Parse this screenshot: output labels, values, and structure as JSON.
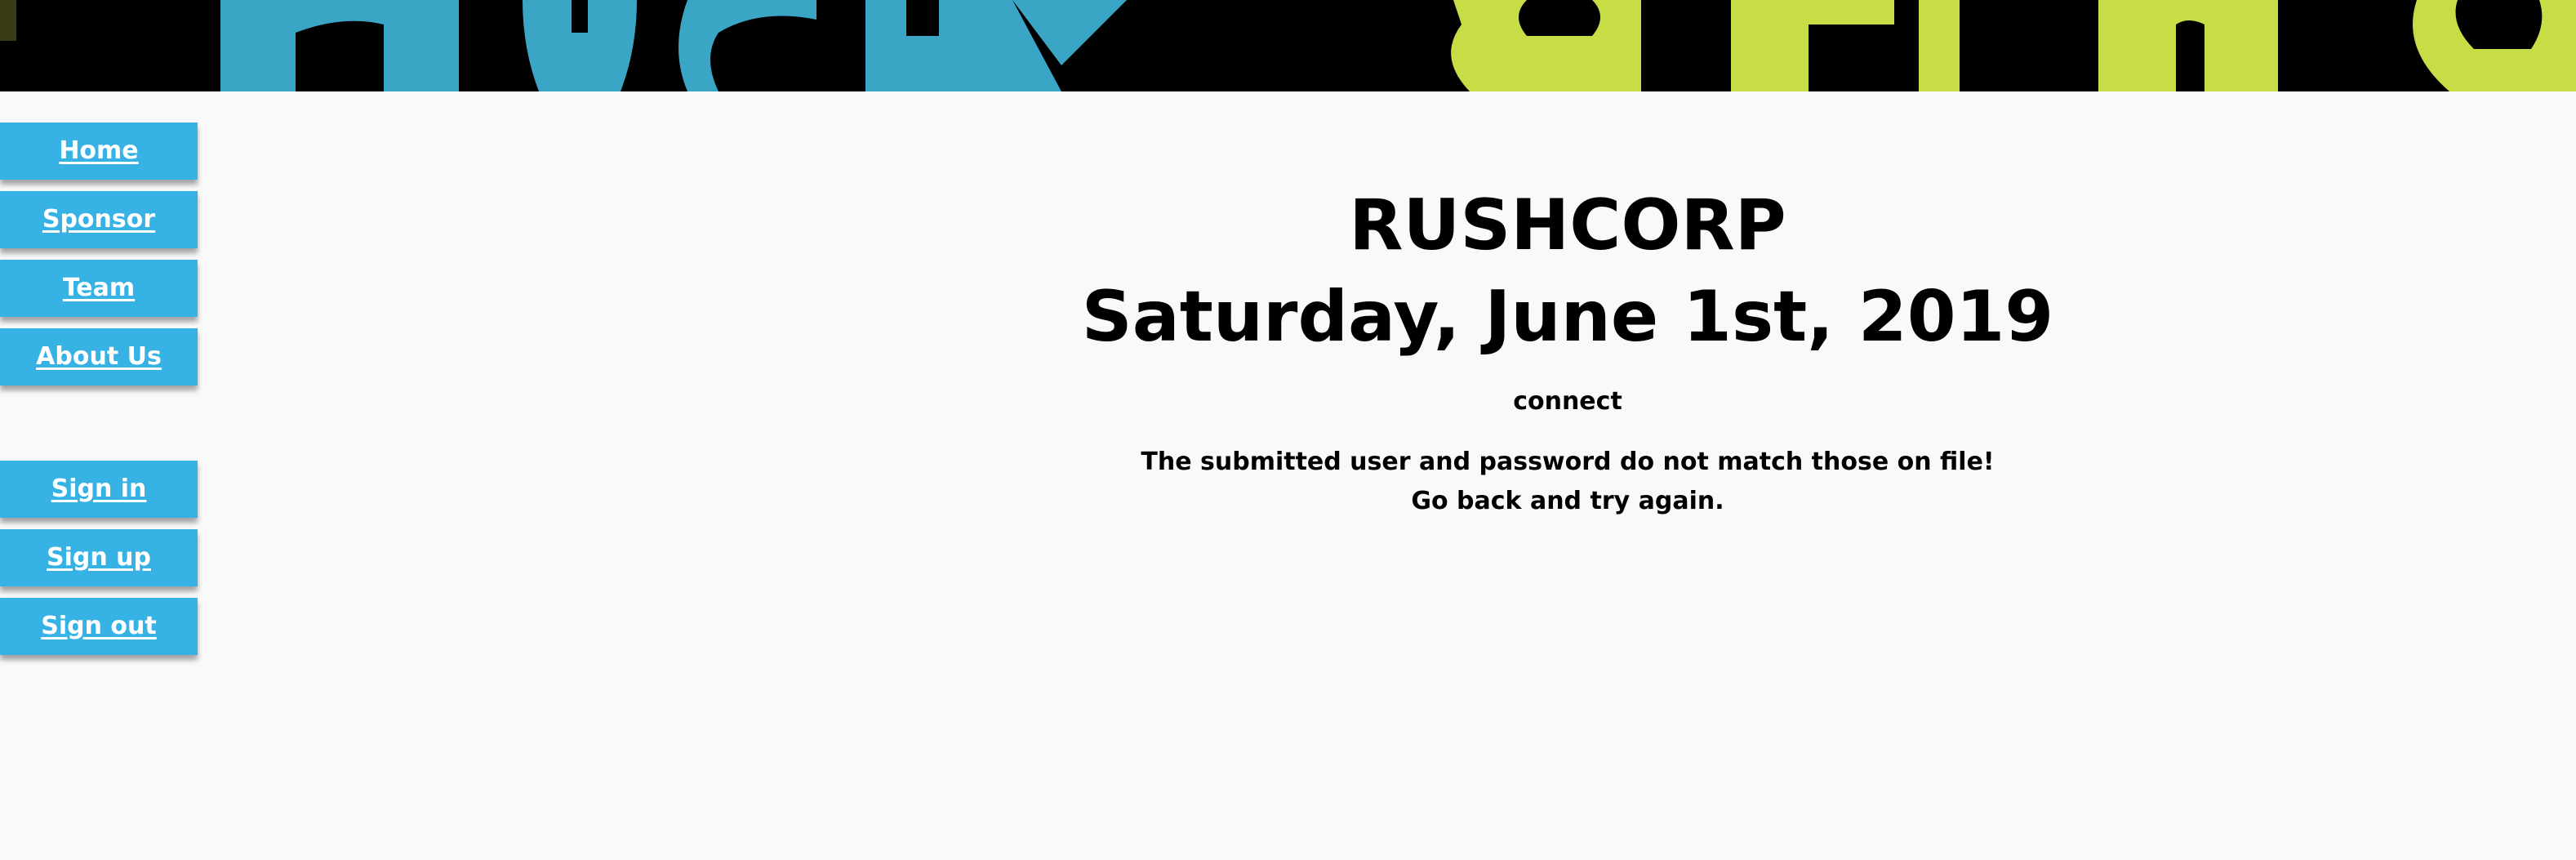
{
  "banner": {
    "logo_text": "hackathon",
    "colors": {
      "background": "#000000",
      "blue": "#3aa5c4",
      "green": "#c8dc46"
    }
  },
  "sidebar": {
    "primary": [
      {
        "label": "Home"
      },
      {
        "label": "Sponsor"
      },
      {
        "label": "Team"
      },
      {
        "label": "About Us"
      }
    ],
    "account": [
      {
        "label": "Sign in"
      },
      {
        "label": "Sign up"
      },
      {
        "label": "Sign out"
      }
    ],
    "button_color": "#37b2e4",
    "label_color": "#ffffff"
  },
  "main": {
    "title": "RUSHCORP",
    "date": "Saturday, June 1st, 2019",
    "section": "connect",
    "error_line_1": "The submitted user and password do not match those on file!",
    "error_line_2": "Go back and try again."
  },
  "colors": {
    "page_background": "#f9f9f9",
    "text": "#000000"
  }
}
